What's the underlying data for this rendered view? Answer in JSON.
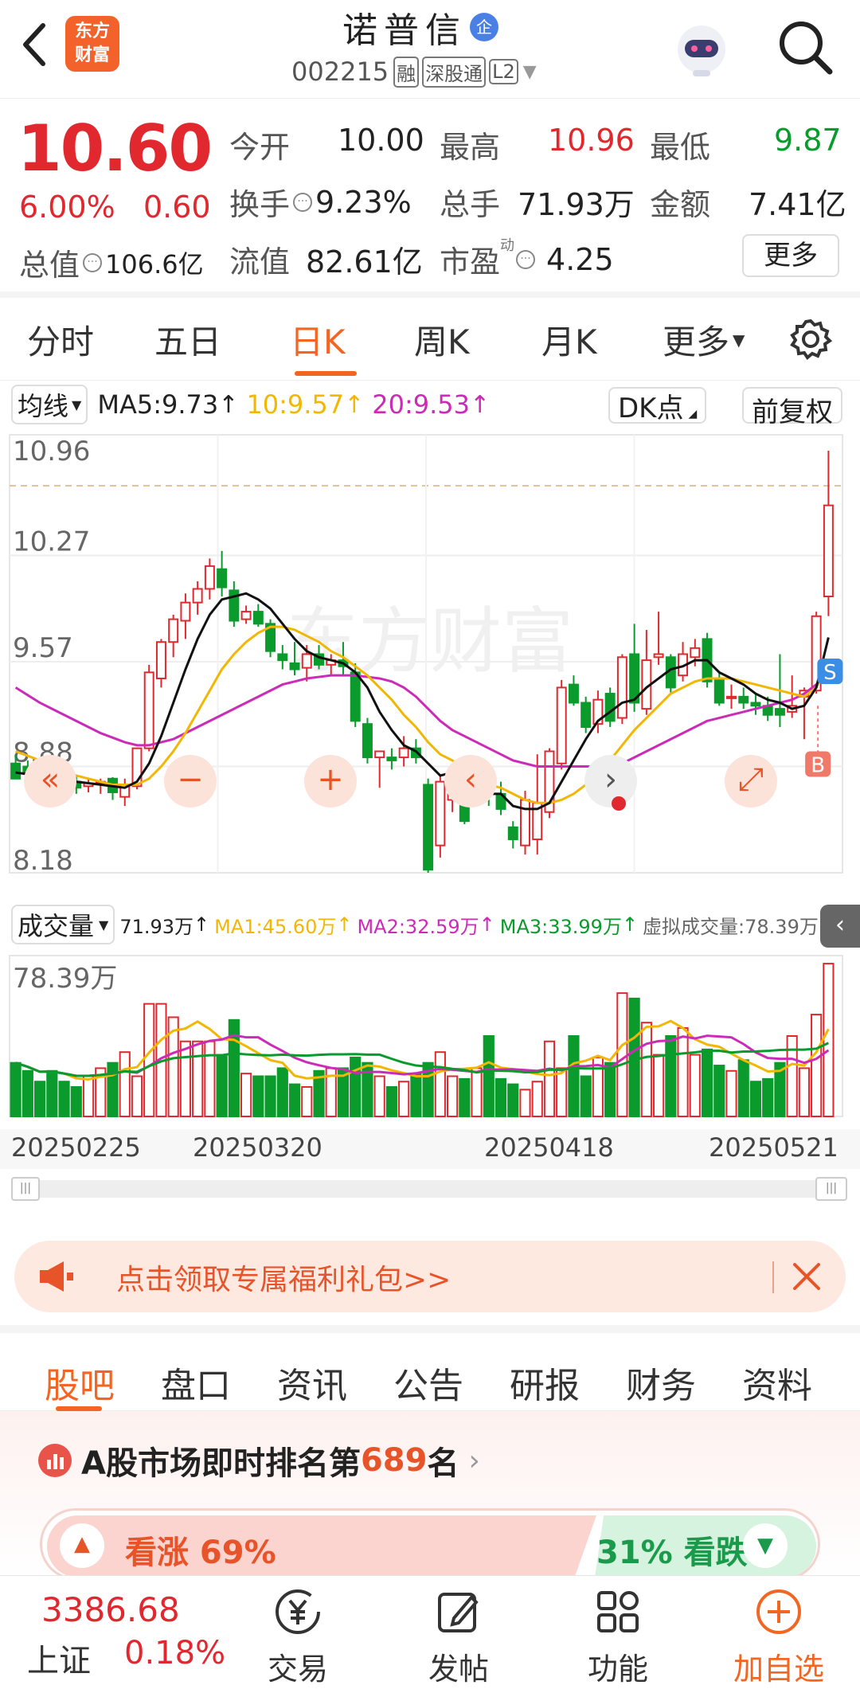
{
  "header": {
    "stock_name": "诺普信",
    "stock_badge": "企",
    "stock_code": "002215",
    "tags": [
      "融",
      "深股通",
      "L2"
    ],
    "logo_lines": [
      "东方",
      "财富"
    ]
  },
  "quote": {
    "price": "10.60",
    "change_pct": "6.00%",
    "change_amt": "0.60",
    "market_cap_label": "总值",
    "market_cap": "106.6亿",
    "stats": [
      {
        "label": "今开",
        "value": "10.00",
        "color": "dark"
      },
      {
        "label": "最高",
        "value": "10.96",
        "color": "red"
      },
      {
        "label": "最低",
        "value": "9.87",
        "color": "green"
      },
      {
        "label": "换手",
        "value": "9.23%",
        "color": "dark"
      },
      {
        "label": "总手",
        "value": "71.93万",
        "color": "dark"
      },
      {
        "label": "金额",
        "value": "7.41亿",
        "color": "dark"
      },
      {
        "label": "流值",
        "value": "82.61亿",
        "color": "dark"
      },
      {
        "label": "市盈",
        "value": "4.25",
        "color": "dark"
      }
    ],
    "pe_superscript": "动",
    "more_label": "更多"
  },
  "period_tabs": {
    "items": [
      "分时",
      "五日",
      "日K",
      "周K",
      "月K",
      "更多"
    ],
    "active_index": 2
  },
  "chart_toolbar": {
    "ma_select": "均线",
    "ma5": "MA5:9.73",
    "ma10": "10:9.57",
    "ma20": "20:9.53",
    "dk_label": "DK点",
    "adjust_label": "前复权"
  },
  "volume_toolbar": {
    "select": "成交量",
    "vol": "71.93万",
    "ma1": "MA1:45.60万",
    "ma2": "MA2:32.59万",
    "ma3": "MA3:33.99万",
    "virtual": "虚拟成交量:78.39万"
  },
  "markers": {
    "sell": "S",
    "buy": "B"
  },
  "chart_data": {
    "type": "candlestick",
    "price_axis_labels": [
      "10.96",
      "10.27",
      "9.57",
      "8.88",
      "8.18"
    ],
    "ylim": [
      8.18,
      10.96
    ],
    "volume_axis_label": "78.39万",
    "x_tick_labels": [
      "20250225",
      "20250320",
      "20250418",
      "20250521"
    ],
    "candles": [
      {
        "o": 8.9,
        "h": 8.96,
        "l": 8.8,
        "c": 8.8
      },
      {
        "o": 8.88,
        "h": 8.92,
        "l": 8.79,
        "c": 8.83
      },
      {
        "o": 8.87,
        "h": 8.9,
        "l": 8.78,
        "c": 8.79
      },
      {
        "o": 8.91,
        "h": 8.92,
        "l": 8.74,
        "c": 8.76
      },
      {
        "o": 8.84,
        "h": 8.87,
        "l": 8.75,
        "c": 8.78
      },
      {
        "o": 8.78,
        "h": 8.82,
        "l": 8.7,
        "c": 8.74
      },
      {
        "o": 8.75,
        "h": 8.8,
        "l": 8.71,
        "c": 8.77
      },
      {
        "o": 8.78,
        "h": 8.8,
        "l": 8.7,
        "c": 8.78
      },
      {
        "o": 8.8,
        "h": 8.81,
        "l": 8.66,
        "c": 8.71
      },
      {
        "o": 8.68,
        "h": 8.8,
        "l": 8.62,
        "c": 8.76
      },
      {
        "o": 8.75,
        "h": 9.0,
        "l": 8.73,
        "c": 9.0
      },
      {
        "o": 9.0,
        "h": 9.55,
        "l": 8.98,
        "c": 9.5
      },
      {
        "o": 9.46,
        "h": 9.72,
        "l": 9.4,
        "c": 9.7
      },
      {
        "o": 9.7,
        "h": 9.88,
        "l": 9.6,
        "c": 9.85
      },
      {
        "o": 9.84,
        "h": 10.02,
        "l": 9.72,
        "c": 9.96
      },
      {
        "o": 9.96,
        "h": 10.1,
        "l": 9.88,
        "c": 10.05
      },
      {
        "o": 10.05,
        "h": 10.25,
        "l": 9.98,
        "c": 10.2
      },
      {
        "o": 10.18,
        "h": 10.3,
        "l": 10.0,
        "c": 10.06
      },
      {
        "o": 10.04,
        "h": 10.1,
        "l": 9.8,
        "c": 9.84
      },
      {
        "o": 9.85,
        "h": 9.94,
        "l": 9.82,
        "c": 9.9
      },
      {
        "o": 9.9,
        "h": 9.95,
        "l": 9.8,
        "c": 9.82
      },
      {
        "o": 9.82,
        "h": 9.85,
        "l": 9.6,
        "c": 9.64
      },
      {
        "o": 9.62,
        "h": 9.68,
        "l": 9.52,
        "c": 9.58
      },
      {
        "o": 9.56,
        "h": 9.7,
        "l": 9.48,
        "c": 9.52
      },
      {
        "o": 9.53,
        "h": 9.68,
        "l": 9.44,
        "c": 9.62
      },
      {
        "o": 9.62,
        "h": 9.68,
        "l": 9.52,
        "c": 9.55
      },
      {
        "o": 9.55,
        "h": 9.62,
        "l": 9.48,
        "c": 9.58
      },
      {
        "o": 9.58,
        "h": 9.7,
        "l": 9.48,
        "c": 9.54
      },
      {
        "o": 9.5,
        "h": 9.56,
        "l": 9.14,
        "c": 9.18
      },
      {
        "o": 9.16,
        "h": 9.2,
        "l": 8.9,
        "c": 8.94
      },
      {
        "o": 8.94,
        "h": 8.98,
        "l": 8.74,
        "c": 8.98
      },
      {
        "o": 8.94,
        "h": 9.0,
        "l": 8.86,
        "c": 8.92
      },
      {
        "o": 8.94,
        "h": 9.08,
        "l": 8.88,
        "c": 9.0
      },
      {
        "o": 9.0,
        "h": 9.06,
        "l": 8.9,
        "c": 8.94
      },
      {
        "o": 8.76,
        "h": 8.8,
        "l": 8.18,
        "c": 8.2
      },
      {
        "o": 8.36,
        "h": 8.82,
        "l": 8.28,
        "c": 8.78
      },
      {
        "o": 8.66,
        "h": 8.85,
        "l": 8.58,
        "c": 8.82
      },
      {
        "o": 8.68,
        "h": 8.72,
        "l": 8.5,
        "c": 8.52
      },
      {
        "o": 8.8,
        "h": 8.92,
        "l": 8.76,
        "c": 8.86
      },
      {
        "o": 8.82,
        "h": 8.86,
        "l": 8.62,
        "c": 8.7
      },
      {
        "o": 8.7,
        "h": 8.78,
        "l": 8.56,
        "c": 8.6
      },
      {
        "o": 8.48,
        "h": 8.52,
        "l": 8.34,
        "c": 8.4
      },
      {
        "o": 8.36,
        "h": 8.72,
        "l": 8.3,
        "c": 8.66
      },
      {
        "o": 8.4,
        "h": 8.96,
        "l": 8.3,
        "c": 8.64
      },
      {
        "o": 8.58,
        "h": 9.0,
        "l": 8.54,
        "c": 8.98
      },
      {
        "o": 8.9,
        "h": 9.45,
        "l": 8.86,
        "c": 9.4
      },
      {
        "o": 9.42,
        "h": 9.48,
        "l": 9.28,
        "c": 9.3
      },
      {
        "o": 9.3,
        "h": 9.34,
        "l": 9.1,
        "c": 9.14
      },
      {
        "o": 9.16,
        "h": 9.38,
        "l": 9.1,
        "c": 9.32
      },
      {
        "o": 9.36,
        "h": 9.4,
        "l": 9.14,
        "c": 9.18
      },
      {
        "o": 9.2,
        "h": 9.62,
        "l": 9.16,
        "c": 9.6
      },
      {
        "o": 9.62,
        "h": 9.82,
        "l": 9.24,
        "c": 9.3
      },
      {
        "o": 9.26,
        "h": 9.78,
        "l": 9.22,
        "c": 9.58
      },
      {
        "o": 9.6,
        "h": 9.9,
        "l": 9.55,
        "c": 9.62
      },
      {
        "o": 9.6,
        "h": 9.62,
        "l": 9.36,
        "c": 9.4
      },
      {
        "o": 9.48,
        "h": 9.7,
        "l": 9.44,
        "c": 9.62
      },
      {
        "o": 9.6,
        "h": 9.72,
        "l": 9.54,
        "c": 9.66
      },
      {
        "o": 9.72,
        "h": 9.76,
        "l": 9.4,
        "c": 9.44
      },
      {
        "o": 9.46,
        "h": 9.5,
        "l": 9.28,
        "c": 9.3
      },
      {
        "o": 9.34,
        "h": 9.42,
        "l": 9.26,
        "c": 9.34
      },
      {
        "o": 9.34,
        "h": 9.4,
        "l": 9.26,
        "c": 9.3
      },
      {
        "o": 9.3,
        "h": 9.36,
        "l": 9.22,
        "c": 9.28
      },
      {
        "o": 9.28,
        "h": 9.34,
        "l": 9.18,
        "c": 9.22
      },
      {
        "o": 9.26,
        "h": 9.62,
        "l": 9.14,
        "c": 9.22
      },
      {
        "o": 9.24,
        "h": 9.48,
        "l": 9.2,
        "c": 9.28
      },
      {
        "o": 9.34,
        "h": 9.4,
        "l": 9.06,
        "c": 9.38
      },
      {
        "o": 9.38,
        "h": 9.9,
        "l": 9.36,
        "c": 9.87
      },
      {
        "o": 10.0,
        "h": 10.96,
        "l": 9.87,
        "c": 10.6
      }
    ],
    "ma5": [
      8.84,
      8.83,
      8.81,
      8.8,
      8.79,
      8.78,
      8.77,
      8.76,
      8.75,
      8.74,
      8.78,
      8.9,
      9.08,
      9.3,
      9.52,
      9.72,
      9.88,
      9.98,
      10.0,
      10.02,
      9.98,
      9.92,
      9.82,
      9.72,
      9.64,
      9.6,
      9.58,
      9.56,
      9.5,
      9.4,
      9.24,
      9.12,
      9.02,
      8.98,
      8.9,
      8.82,
      8.84,
      8.78,
      8.74,
      8.7,
      8.7,
      8.62,
      8.6,
      8.6,
      8.64,
      8.78,
      8.92,
      9.06,
      9.18,
      9.24,
      9.3,
      9.32,
      9.4,
      9.46,
      9.52,
      9.54,
      9.58,
      9.58,
      9.5,
      9.46,
      9.42,
      9.36,
      9.32,
      9.3,
      9.26,
      9.28,
      9.4,
      9.73
    ],
    "ma10": [
      8.98,
      8.95,
      8.92,
      8.88,
      8.85,
      8.82,
      8.8,
      8.78,
      8.76,
      8.76,
      8.76,
      8.8,
      8.88,
      8.98,
      9.1,
      9.24,
      9.38,
      9.52,
      9.62,
      9.7,
      9.76,
      9.8,
      9.8,
      9.78,
      9.74,
      9.7,
      9.64,
      9.6,
      9.54,
      9.48,
      9.4,
      9.32,
      9.22,
      9.14,
      9.04,
      8.96,
      8.92,
      8.86,
      8.8,
      8.76,
      8.74,
      8.7,
      8.66,
      8.64,
      8.64,
      8.66,
      8.7,
      8.76,
      8.84,
      8.92,
      9.02,
      9.12,
      9.2,
      9.28,
      9.36,
      9.4,
      9.44,
      9.46,
      9.46,
      9.46,
      9.44,
      9.42,
      9.4,
      9.38,
      9.36,
      9.34,
      9.4,
      9.57
    ],
    "ma20": [
      9.4,
      9.35,
      9.3,
      9.26,
      9.22,
      9.18,
      9.14,
      9.1,
      9.07,
      9.04,
      9.02,
      9.02,
      9.04,
      9.06,
      9.1,
      9.14,
      9.18,
      9.22,
      9.26,
      9.3,
      9.34,
      9.38,
      9.42,
      9.44,
      9.46,
      9.47,
      9.48,
      9.48,
      9.48,
      9.47,
      9.46,
      9.44,
      9.4,
      9.34,
      9.26,
      9.18,
      9.12,
      9.08,
      9.04,
      9.0,
      8.96,
      8.92,
      8.9,
      8.88,
      8.88,
      8.88,
      8.88,
      8.88,
      8.88,
      8.88,
      8.9,
      8.94,
      8.98,
      9.02,
      9.06,
      9.1,
      9.14,
      9.18,
      9.2,
      9.22,
      9.24,
      9.26,
      9.28,
      9.3,
      9.32,
      9.36,
      9.42,
      9.53
    ],
    "volume": [
      20,
      17,
      13,
      17,
      13,
      11,
      15,
      18,
      20,
      24,
      15,
      42,
      42,
      37,
      28,
      28,
      28,
      23,
      36,
      16,
      15,
      15,
      18,
      12,
      11,
      17,
      18,
      18,
      22,
      20,
      15,
      11,
      13,
      16,
      20,
      24,
      15,
      14,
      18,
      30,
      14,
      12,
      10,
      13,
      28,
      18,
      30,
      15,
      22,
      20,
      46,
      44,
      35,
      23,
      30,
      33,
      23,
      25,
      19,
      17,
      21,
      13,
      14,
      20,
      30,
      18,
      38,
      57
    ]
  },
  "chart_controls": [
    "«",
    "−",
    "+",
    "‹",
    "›",
    "⤢"
  ],
  "promo": {
    "text": "点击领取专属福利礼包>>"
  },
  "section_tabs": {
    "items": [
      "股吧",
      "盘口",
      "资讯",
      "公告",
      "研报",
      "财务",
      "资料"
    ],
    "active_index": 0
  },
  "ranking": {
    "prefix": "A股市场即时排名第",
    "rank": "689",
    "suffix": "名",
    "bull_label": "看涨 69%",
    "bear_label": "31% 看跌",
    "bull_pct": 69
  },
  "bottom_bar": {
    "index_value": "3386.68",
    "index_name": "上证",
    "index_change": "0.18%",
    "items": [
      "交易",
      "发帖",
      "功能",
      "加自选"
    ]
  },
  "colors": {
    "up": "#e0282e",
    "down": "#0a9b2c",
    "accent": "#f26522",
    "ma10": "#f2b705",
    "ma20": "#cc2bb7"
  }
}
